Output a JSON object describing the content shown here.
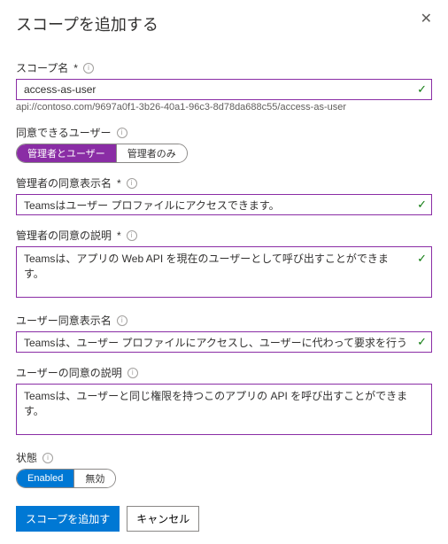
{
  "header": {
    "title": "スコープを追加する"
  },
  "scopeName": {
    "label": "スコープ名",
    "value": "access-as-user",
    "hint": "api://contoso.com/9697a0f1-3b26-40a1-96c3-8d78da688c55/access-as-user"
  },
  "consentUsers": {
    "label": "同意できるユーザー",
    "option1": "管理者とユーザー",
    "option2": "管理者のみ"
  },
  "adminDisplay": {
    "label": "管理者の同意表示名",
    "value": "Teamsはユーザー プロファイルにアクセスできます。"
  },
  "adminDesc": {
    "label": "管理者の同意の説明",
    "value": "Teamsは、アプリの Web API を現在のユーザーとして呼び出すことができます。"
  },
  "userDisplay": {
    "label": "ユーザー同意表示名",
    "value": "Teamsは、ユーザー プロファイルにアクセスし、ユーザーに代わって要求を行うことができます。"
  },
  "userDesc": {
    "label": "ユーザーの同意の説明",
    "value": "Teamsは、ユーザーと同じ権限を持つこのアプリの API を呼び出すことができます。"
  },
  "state": {
    "label": "状態",
    "enabled": "Enabled",
    "disabled": "無効"
  },
  "footer": {
    "add": "スコープを追加す",
    "cancel": "キャンセル"
  }
}
